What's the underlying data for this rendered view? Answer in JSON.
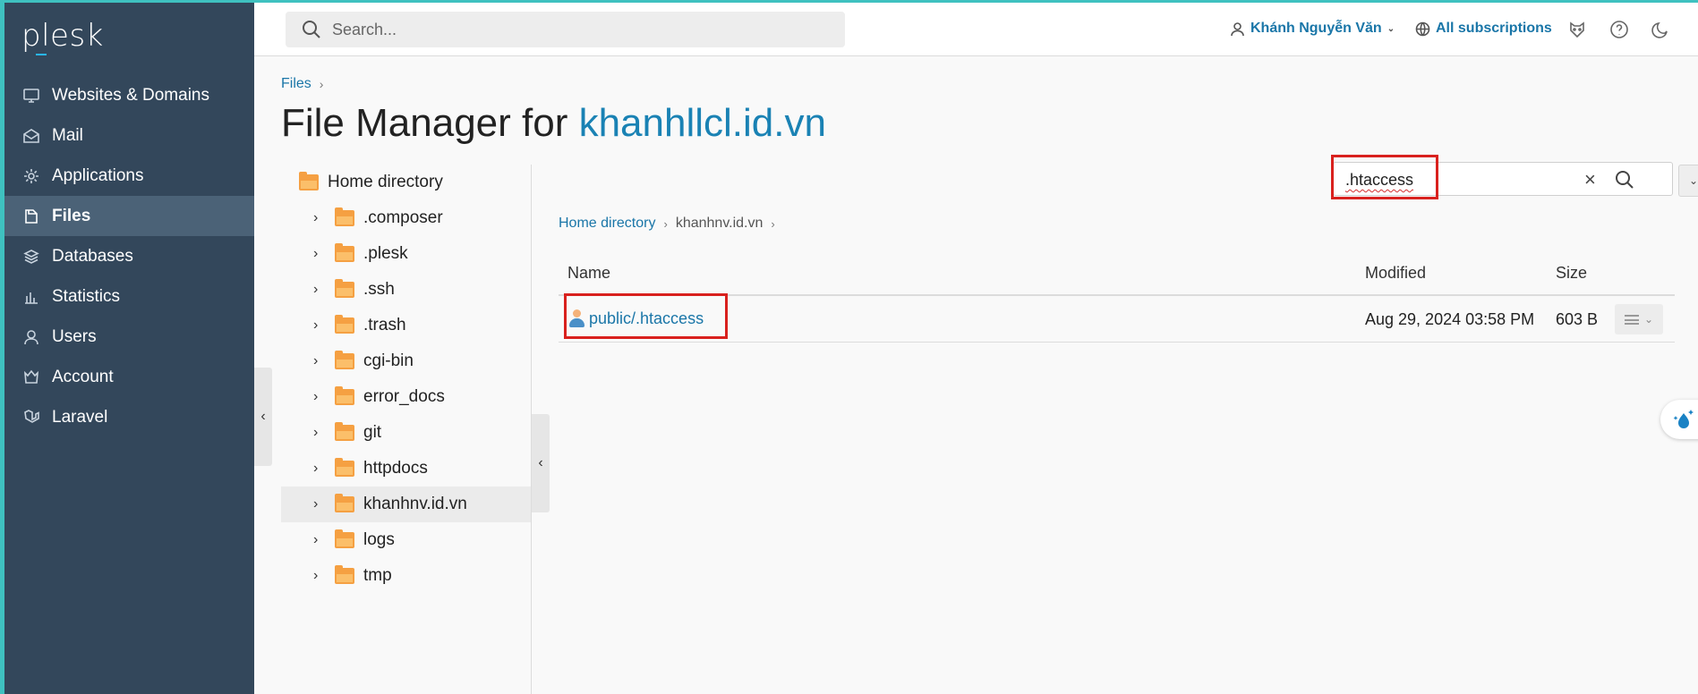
{
  "sidebar": {
    "logo": "plesk",
    "items": [
      {
        "label": "Websites & Domains",
        "icon": "monitor-icon"
      },
      {
        "label": "Mail",
        "icon": "mail-icon"
      },
      {
        "label": "Applications",
        "icon": "gear-icon"
      },
      {
        "label": "Files",
        "icon": "files-icon",
        "active": true
      },
      {
        "label": "Databases",
        "icon": "database-icon"
      },
      {
        "label": "Statistics",
        "icon": "bar-chart-icon"
      },
      {
        "label": "Users",
        "icon": "user-icon"
      },
      {
        "label": "Account",
        "icon": "account-icon"
      },
      {
        "label": "Laravel",
        "icon": "laravel-icon"
      }
    ]
  },
  "header": {
    "search_placeholder": "Search...",
    "user_name": "Khánh Nguyễn Văn",
    "subscriptions": "All subscriptions"
  },
  "breadcrumb": {
    "root": "Files"
  },
  "title": {
    "prefix": "File Manager for ",
    "domain": "khanhllcl.id.vn"
  },
  "tree": {
    "root": "Home directory",
    "folders": [
      ".composer",
      ".plesk",
      ".ssh",
      ".trash",
      "cgi-bin",
      "error_docs",
      "git",
      "httpdocs",
      "khanhnv.id.vn",
      "logs",
      "tmp"
    ],
    "selected": "khanhnv.id.vn"
  },
  "file_search": {
    "value": ".htaccess"
  },
  "path": {
    "home": "Home directory",
    "current": "khanhnv.id.vn"
  },
  "table": {
    "columns": {
      "name": "Name",
      "modified": "Modified",
      "size": "Size"
    },
    "rows": [
      {
        "name": "public/.htaccess",
        "modified": "Aug 29, 2024 03:58 PM",
        "size": "603 B"
      }
    ]
  },
  "colors": {
    "sidebar": "#33475b",
    "accent": "#1a76a8",
    "highlight": "#d9211e",
    "teal_border": "#3fc1c0"
  }
}
